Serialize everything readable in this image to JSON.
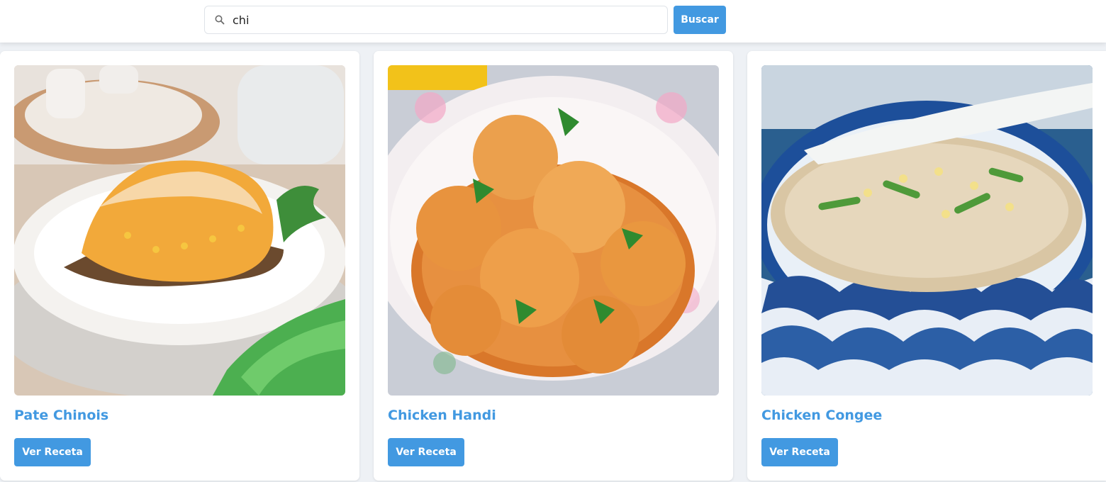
{
  "search": {
    "value": "chi",
    "button_label": "Buscar",
    "icon": "search-icon"
  },
  "colors": {
    "accent": "#4299e1",
    "page_bg": "#eef1f5",
    "card_bg": "#ffffff"
  },
  "recipes": [
    {
      "title": "Pate Chinois",
      "button_label": "Ver Receta",
      "image": "shepherds-pie-photo"
    },
    {
      "title": "Chicken Handi",
      "button_label": "Ver Receta",
      "image": "chicken-curry-photo"
    },
    {
      "title": "Chicken Congee",
      "button_label": "Ver Receta",
      "image": "congee-bowl-photo"
    }
  ]
}
